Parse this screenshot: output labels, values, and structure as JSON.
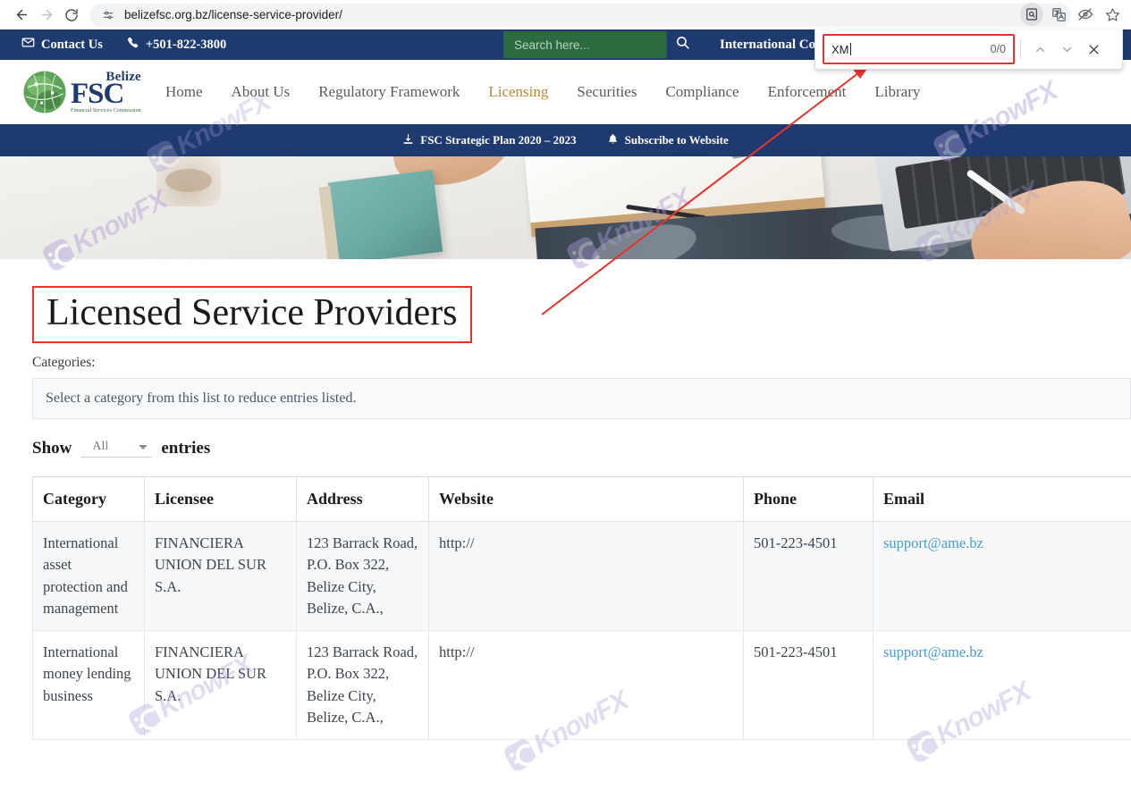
{
  "browser": {
    "url": "belizefsc.org.bz/license-service-provider/",
    "back_icon": "back-arrow-icon",
    "forward_icon": "forward-arrow-icon",
    "reload_icon": "reload-icon",
    "site_settings_icon": "site-settings-icon",
    "toolbar_icons": [
      "find-in-page-icon",
      "translate-icon",
      "eye-off-icon",
      "bookmark-star-icon"
    ]
  },
  "find_bar": {
    "query": "XM",
    "match_count": "0/0",
    "previous_icon": "chevron-up-icon",
    "next_icon": "chevron-down-icon",
    "close_icon": "close-icon"
  },
  "topbar": {
    "contact_label": "Contact Us",
    "contact_icon": "envelope-icon",
    "phone_label": "+501-822-3800",
    "phone_icon": "phone-icon",
    "search_placeholder": "Search here...",
    "search_value": "",
    "search_icon": "search-icon",
    "international_label": "International Co"
  },
  "logo": {
    "belize": "Belize",
    "fsc": "FSC",
    "subtitle": "Financial Services Commission"
  },
  "nav": {
    "items": [
      {
        "label": "Home",
        "active": false
      },
      {
        "label": "About Us",
        "active": false
      },
      {
        "label": "Regulatory Framework",
        "active": false
      },
      {
        "label": "Licensing",
        "active": true
      },
      {
        "label": "Securities",
        "active": false
      },
      {
        "label": "Compliance",
        "active": false
      },
      {
        "label": "Enforcement",
        "active": false
      },
      {
        "label": "Library",
        "active": false
      }
    ],
    "active_color": "#b5893c"
  },
  "subbar": {
    "strategic_plan_label": "FSC Strategic Plan 2020 – 2023",
    "strategic_plan_icon": "download-icon",
    "subscribe_label": "Subscribe to Website",
    "subscribe_icon": "bell-icon"
  },
  "page": {
    "title": "Licensed Service Providers",
    "categories_label": "Categories:",
    "category_hint": "Select a category from this list to reduce entries listed.",
    "show_label": "Show",
    "entries_value": "All",
    "entries_label": "entries"
  },
  "table": {
    "columns": [
      "Category",
      "Licensee",
      "Address",
      "Website",
      "Phone",
      "Email"
    ],
    "rows": [
      {
        "category": "International asset protection and management",
        "licensee": "FINANCIERA UNION DEL SUR S.A.",
        "address": "123 Barrack Road, P.O. Box 322, Belize City, Belize, C.A.,",
        "website": "http://",
        "phone": "501-223-4501",
        "email": "support@ame.bz"
      },
      {
        "category": "International money lending business",
        "licensee": "FINANCIERA UNION DEL SUR S.A.",
        "address": "123 Barrack Road, P.O. Box 322, Belize City, Belize, C.A.,",
        "website": "http://",
        "phone": "501-223-4501",
        "email": "support@ame.bz"
      }
    ]
  },
  "watermark": {
    "text": "KnowFX"
  },
  "annotation": {
    "color": "#e8332a"
  }
}
